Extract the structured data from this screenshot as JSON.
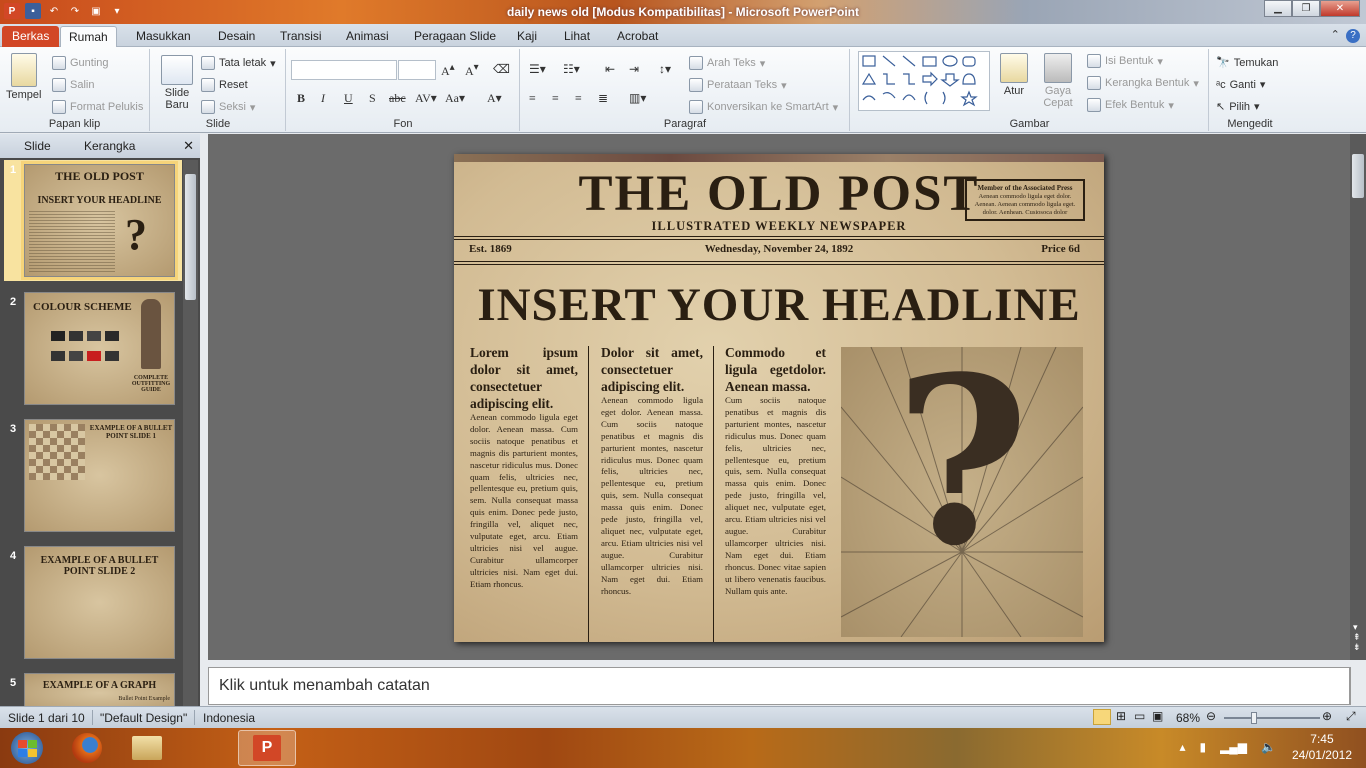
{
  "window": {
    "title": "daily news old [Modus Kompatibilitas]  -  Microsoft PowerPoint"
  },
  "tabs": [
    "Berkas",
    "Rumah",
    "Masukkan",
    "Desain",
    "Transisi",
    "Animasi",
    "Peragaan Slide",
    "Kaji",
    "Lihat",
    "Acrobat"
  ],
  "ribbon": {
    "clipboard": {
      "paste": "Tempel",
      "cut": "Gunting",
      "copy": "Salin",
      "format_painter": "Format Pelukis",
      "label": "Papan klip"
    },
    "slides": {
      "new_slide": "Slide Baru",
      "layout": "Tata letak",
      "reset": "Reset",
      "section": "Seksi",
      "label": "Slide"
    },
    "font": {
      "label": "Fon"
    },
    "paragraph": {
      "text_direction": "Arah Teks",
      "align_text": "Perataan Teks",
      "smartart": "Konversikan ke SmartArt",
      "label": "Paragraf"
    },
    "drawing": {
      "arrange": "Atur",
      "quick_styles": "Gaya Cepat",
      "shape_fill": "Isi Bentuk",
      "shape_outline": "Kerangka Bentuk",
      "shape_effects": "Efek Bentuk",
      "label": "Gambar"
    },
    "editing": {
      "find": "Temukan",
      "replace": "Ganti",
      "select": "Pilih",
      "label": "Mengedit"
    }
  },
  "leftpane": {
    "tab_slides": "Slide",
    "tab_outline": "Kerangka",
    "thumbs": [
      {
        "num": "1",
        "title": "THE OLD POST",
        "sub": "INSERT YOUR HEADLINE",
        "mark": "?"
      },
      {
        "num": "2",
        "title": "COLOUR SCHEME",
        "sub": "COMPLETE OUTFITTING GUIDE"
      },
      {
        "num": "3",
        "title": "EXAMPLE OF A BULLET POINT SLIDE 1",
        "sub": ""
      },
      {
        "num": "4",
        "title": "EXAMPLE OF A BULLET POINT SLIDE 2",
        "sub": ""
      },
      {
        "num": "5",
        "title": "EXAMPLE OF A GRAPH",
        "sub": "Bullet Point Example"
      }
    ]
  },
  "slide": {
    "masthead": "THE OLD POST",
    "subtitle": "ILLUSTRATED WEEKLY NEWSPAPER",
    "ap_title": "Member of the Associated Press",
    "ap_text": "Aenean commodo ligula eget dolor. Aenean. Aenean commodo ligula eget. dolor. Aenhean. Cusiosoca dolor",
    "est": "Est. 1869",
    "date": "Wednesday, November 24, 1892",
    "price": "Price 6d",
    "headline": "INSERT YOUR HEADLINE",
    "col1_lead": "Lorem ipsum dolor sit amet, consectetuer adipiscing elit.",
    "col1_body": "Aenean commodo ligula eget dolor. Aenean massa. Cum sociis natoque penatibus et magnis dis parturient montes, nascetur ridiculus mus. Donec quam felis, ultricies nec, pellentesque eu, pretium quis, sem. Nulla consequat massa quis enim. Donec pede justo, fringilla vel, aliquet nec, vulputate eget, arcu. Etiam ultricies nisi vel augue. Curabitur ullamcorper ultricies nisi. Nam eget dui. Etiam rhoncus.",
    "col2_lead": "Dolor sit amet, consectetuer adipiscing elit.",
    "col2_body": "Aenean commodo ligula eget dolor. Aenean massa. Cum sociis natoque penatibus et magnis dis parturient montes, nascetur ridiculus mus. Donec quam felis, ultricies nec, pellentesque eu, pretium quis, sem. Nulla consequat massa quis enim. Donec pede justo, fringilla vel, aliquet nec, vulputate eget, arcu. Etiam ultricies nisi vel augue. Curabitur ullamcorper ultricies nisi. Nam eget dui. Etiam rhoncus.",
    "col3_lead": "Commodo et ligula egetdolor. Aenean massa.",
    "col3_body": "Cum sociis natoque penatibus et magnis dis parturient montes, nascetur ridiculus mus. Donec quam felis, ultricies nec, pellentesque eu, pretium quis, sem. Nulla consequat massa quis enim. Donec pede justo, fringilla vel, aliquet nec, vulputate eget, arcu. Etiam ultricies nisi vel augue. Curabitur ullamcorper ultricies nisi. Nam eget dui. Etiam rhoncus. Donec vitae sapien ut libero venenatis faucibus. Nullam quis ante.",
    "image_mark": "?"
  },
  "notes": {
    "placeholder": "Klik untuk menambah catatan"
  },
  "status": {
    "slide": "Slide 1 dari 10",
    "theme": "\"Default Design\"",
    "language": "Indonesia",
    "zoom": "68%"
  },
  "taskbar": {
    "time": "7:45",
    "date": "24/01/2012"
  },
  "colors": {
    "file_tab": "#d24726",
    "paper": "#d2bb93",
    "ink": "#2a1f12"
  }
}
